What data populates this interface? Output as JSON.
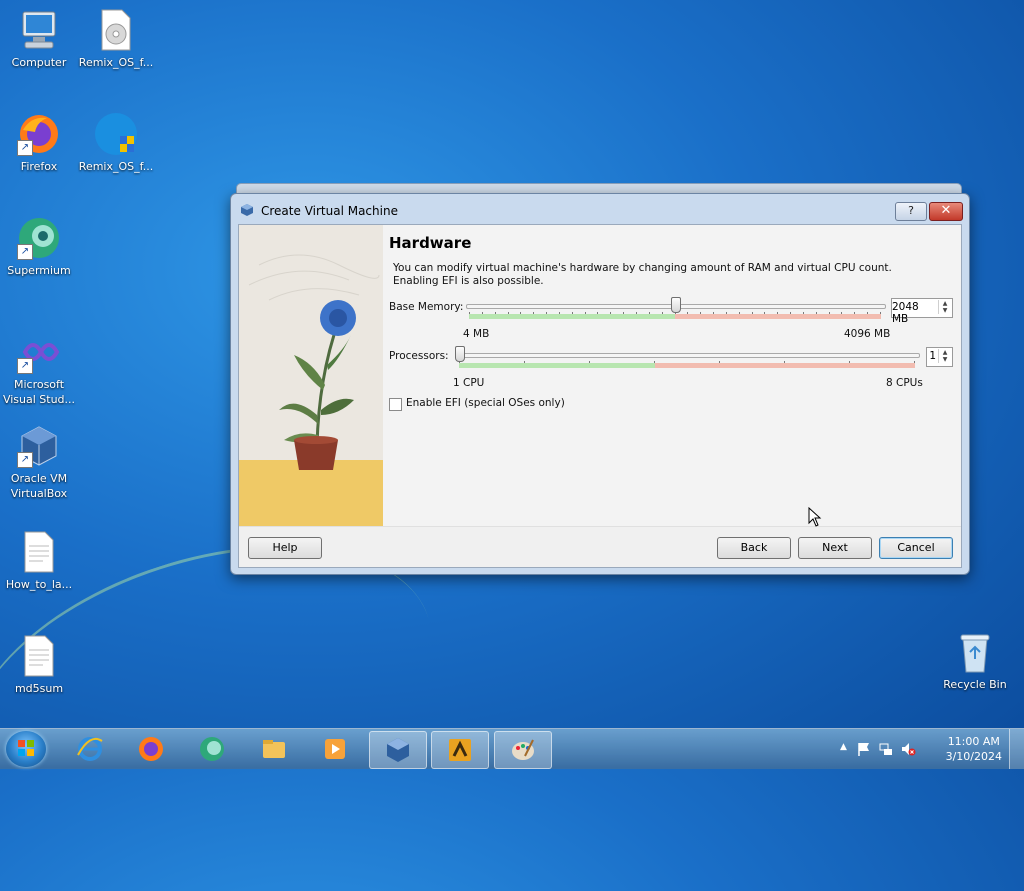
{
  "desktop": {
    "icons": [
      {
        "label": "Computer",
        "name": "computer"
      },
      {
        "label": "Remix_OS_f...",
        "name": "remix-os-iso"
      },
      {
        "label": "Firefox",
        "name": "firefox"
      },
      {
        "label": "Remix_OS_f...",
        "name": "remix-os-installer"
      },
      {
        "label": "Supermium",
        "name": "supermium"
      },
      {
        "label": "Microsoft",
        "label2": "Visual Stud...",
        "name": "visual-studio"
      },
      {
        "label": "Oracle VM",
        "label2": "VirtualBox",
        "name": "virtualbox"
      },
      {
        "label": "How_to_la...",
        "name": "how-to-file"
      },
      {
        "label": "md5sum",
        "name": "md5sum-file"
      },
      {
        "label": "Recycle Bin",
        "name": "recycle-bin"
      }
    ]
  },
  "dialog": {
    "title": "Create Virtual Machine",
    "help_glyph": "?",
    "close_glyph": "✕",
    "heading": "Hardware",
    "description_line1": "You can modify virtual machine's hardware by changing amount of RAM and virtual CPU count.",
    "description_line2": "Enabling EFI is also possible.",
    "memory": {
      "label": "Base Memory:",
      "value": "2048 MB",
      "min": "4 MB",
      "max": "4096 MB",
      "fraction": 0.5,
      "recommended_fraction": 0.5
    },
    "processors": {
      "label": "Processors:",
      "value": "1",
      "min": "1 CPU",
      "max": "8 CPUs",
      "fraction": 0.0,
      "recommended_fraction": 0.43
    },
    "efi": {
      "label": "Enable EFI (special OSes only)",
      "checked": false
    },
    "buttons": {
      "help": "Help",
      "back": "Back",
      "next": "Next",
      "cancel": "Cancel"
    }
  },
  "taskbar": {
    "items": [
      "internet-explorer",
      "firefox",
      "supermium",
      "file-explorer",
      "media-player",
      "virtualbox",
      "remix-os-tool",
      "paint"
    ],
    "clock_time": "11:00 AM",
    "clock_date": "3/10/2024",
    "tray_expand_glyph": "▲"
  },
  "colors": {
    "accent": "#3c7fb1",
    "memory_ok": "#b8e6b0",
    "memory_high": "#f2bcb0"
  }
}
